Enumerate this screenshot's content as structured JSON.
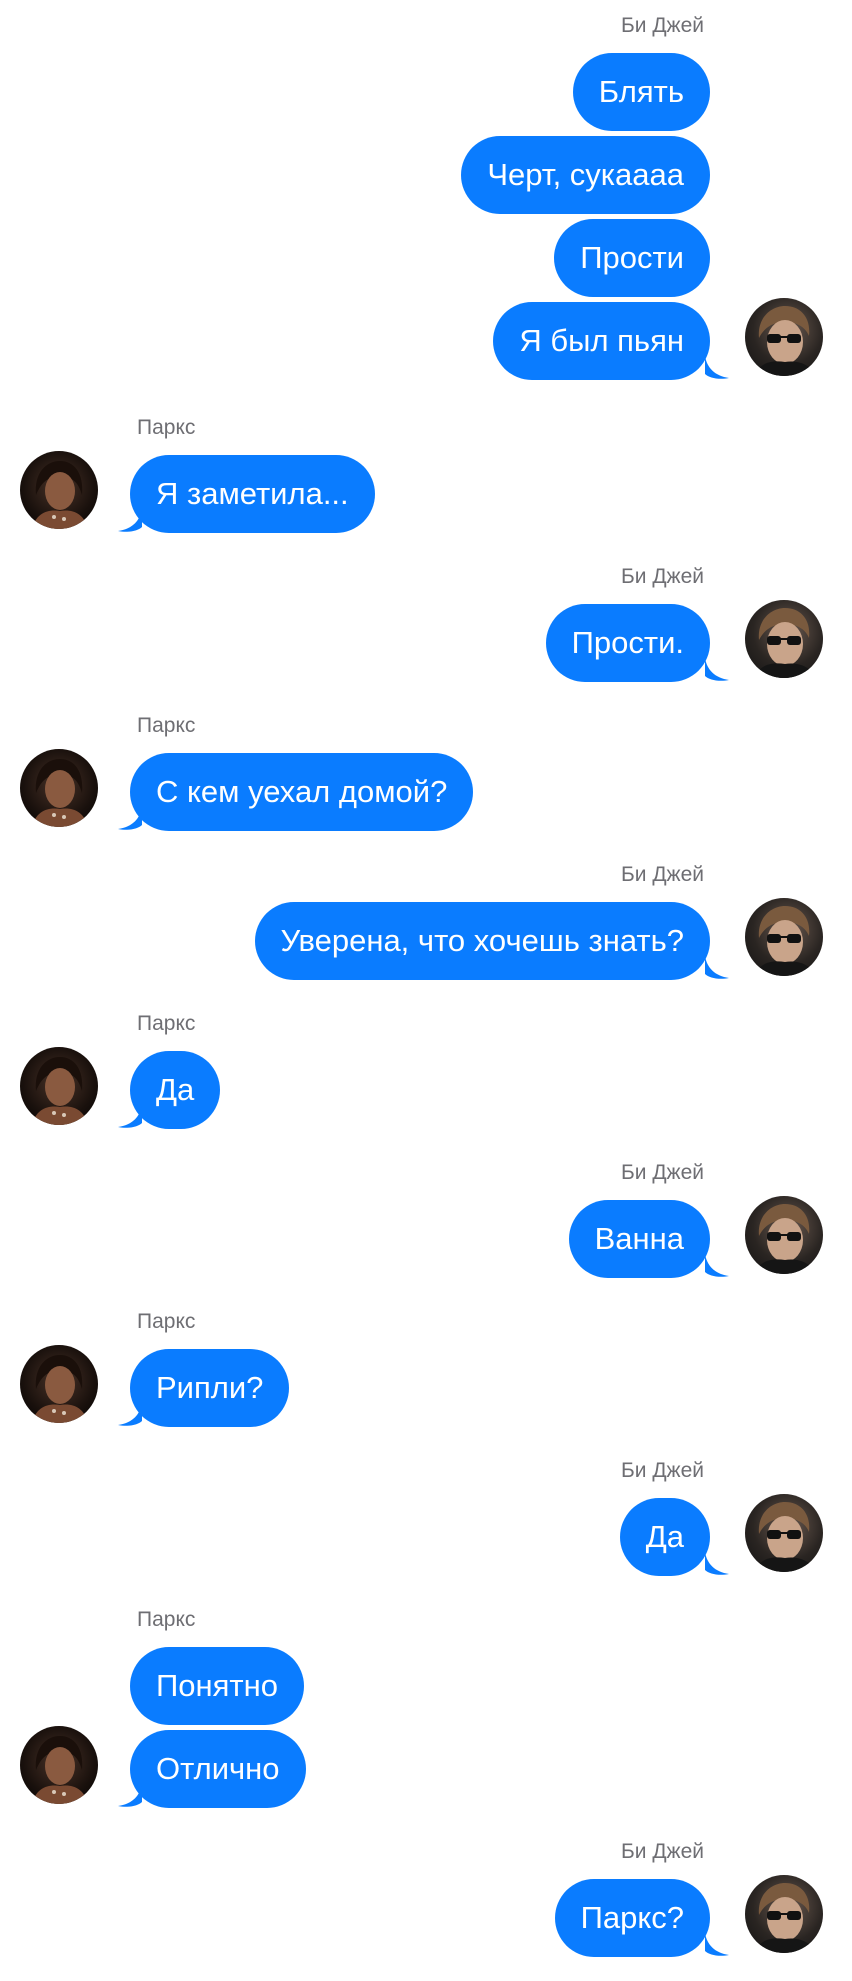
{
  "participants": {
    "bj": {
      "name": "Би Джей"
    },
    "parks": {
      "name": "Паркс"
    }
  },
  "colors": {
    "bubble": "#0a7cff",
    "bubble_text": "#ffffff",
    "name_text": "#6e6e73",
    "background": "#ffffff"
  },
  "groups": [
    {
      "sender": "Би Джей",
      "messages": [
        "Блять",
        "Черт, сукаааа",
        "Прости",
        "Я был пьян"
      ]
    },
    {
      "sender": "Паркс",
      "messages": [
        "Я заметила..."
      ]
    },
    {
      "sender": "Би Джей",
      "messages": [
        "Прости."
      ]
    },
    {
      "sender": "Паркс",
      "messages": [
        "С кем уехал домой?"
      ]
    },
    {
      "sender": "Би Джей",
      "messages": [
        "Уверена, что хочешь знать?"
      ]
    },
    {
      "sender": "Паркс",
      "messages": [
        "Да"
      ]
    },
    {
      "sender": "Би Джей",
      "messages": [
        "Ванна"
      ]
    },
    {
      "sender": "Паркс",
      "messages": [
        "Рипли?"
      ]
    },
    {
      "sender": "Би Джей",
      "messages": [
        "Да"
      ]
    },
    {
      "sender": "Паркс",
      "messages": [
        "Понятно",
        "Отлично"
      ]
    },
    {
      "sender": "Би Джей",
      "messages": [
        "Паркс?"
      ]
    }
  ]
}
